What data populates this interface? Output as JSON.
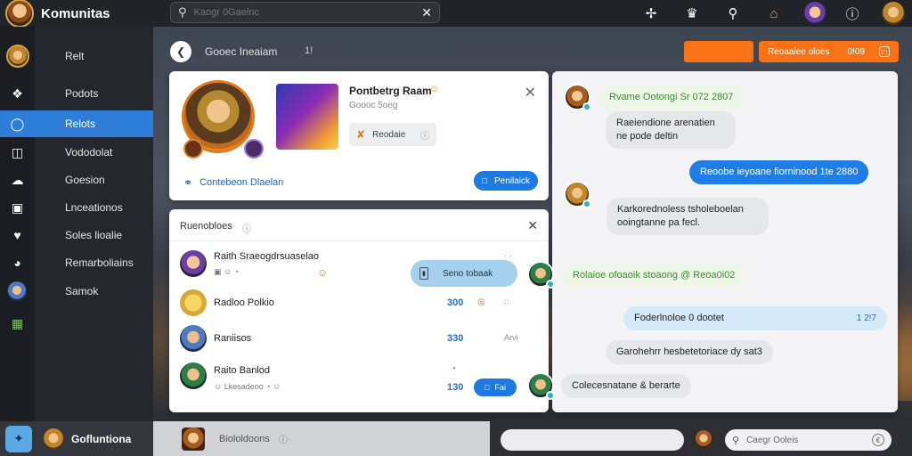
{
  "app": {
    "title": "Komunitas"
  },
  "top_search": {
    "placeholder": "Kaogr 0Gaelnc",
    "clear_icon": "close-icon"
  },
  "top_icons": [
    "shirt-icon",
    "controller-icon",
    "search-icon",
    "shop-icon",
    "avatar",
    "info-icon",
    "avatar"
  ],
  "sidebar": {
    "items": [
      {
        "label": "Relt",
        "icon": "avatar"
      },
      {
        "label": "Podots",
        "icon": "puzzle-icon"
      },
      {
        "label": "Relots",
        "icon": "gamepad-icon"
      },
      {
        "label": "Vododolat",
        "icon": "bag-icon"
      },
      {
        "label": "Goesion",
        "icon": "cloud-icon"
      },
      {
        "label": "Lnceationos",
        "icon": "tv-icon"
      },
      {
        "label": "Soles lioalie",
        "icon": "heart-icon"
      },
      {
        "label": "Remarboliains",
        "icon": "clock-icon"
      },
      {
        "label": "Samok",
        "icon": "avatar"
      }
    ],
    "active_index": 2,
    "extra_icon": "calendar-icon"
  },
  "header": {
    "back_icon": "back-icon",
    "title": "Gooec Ineaiam",
    "count": "1!",
    "pill_label": "Reoaaiee oloes",
    "pill_value": "0!09",
    "pill_icon": "window-icon"
  },
  "profile": {
    "name": "Pontbetrg Raam",
    "name_emoji": "☺",
    "subtitle": "Goooc 5oeg",
    "tag_label": "Reodaie",
    "tag_icon": "tool-icon",
    "tag_end_icon": "info-icon",
    "link_label": "Contebeon Dlaelan",
    "link_icon": "link-icon",
    "button_label": "Penilaick",
    "button_icon": "copy-icon",
    "close_icon": "close-icon"
  },
  "members": {
    "title": "Ruenobloes",
    "title_icon": "info-icon",
    "close_icon": "close-icon",
    "rows": [
      {
        "name": "Raith Sraeogdrsuaselao",
        "sub": "▣ ☺ ◔",
        "score": "",
        "extra": "· ·",
        "emoji": "☺"
      },
      {
        "name": "Radloo Polkio",
        "sub": "",
        "score": "300",
        "extra": "∷",
        "emoji": "◎"
      },
      {
        "name": "Raniisos",
        "sub": "",
        "score": "330",
        "extra": "Arvi",
        "emoji": ""
      },
      {
        "name": "Raito Banlod",
        "sub": "☺ Lkesadeoo ◔ ☺",
        "score": "130",
        "extra": "",
        "emoji": "◔",
        "button": "Fai"
      }
    ]
  },
  "chat": {
    "strip_label": "Seno tobaak",
    "messages": [
      {
        "text": "Rvame Ootongi Sr 072 2807",
        "style": "green"
      },
      {
        "text": "Raeiendione arenatien ne pode deltin",
        "style": "grey"
      },
      {
        "text": "Reoobe ieyoane fiorninood 1te 2880",
        "style": "blue"
      },
      {
        "text": "Karkorednoless tsholeboelan ooingtanne pa fecl.",
        "style": "grey"
      },
      {
        "text": "Rolaioe ofoaoik stoaong @ Reoa0i02",
        "style": "green"
      },
      {
        "text": "Foderlnoloe 0 dootet",
        "style": "lightblue",
        "badge": "1 2!7"
      },
      {
        "text": "Garohehrr hesbetetoriace dy sat3",
        "style": "grey"
      },
      {
        "text": "Colecesnatane & berarte",
        "style": "grey"
      }
    ]
  },
  "bottombar": {
    "user_name": "Gofluntiona",
    "middle_text": "Biololdoons",
    "middle_icon": "info-icon",
    "search_placeholder": "Caegr Ooleis",
    "search_icon": "search-icon",
    "search_end_icon": "info-icon"
  },
  "colors": {
    "accent_blue": "#2e7dd8",
    "accent_orange": "#f97316",
    "chat_green": "#3a8f2a"
  }
}
